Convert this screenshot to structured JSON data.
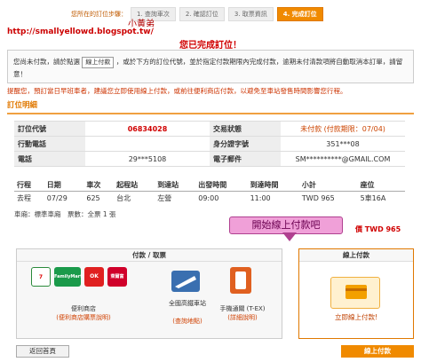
{
  "progress": {
    "label": "您所在的訂位步驟：",
    "steps": [
      "1. 查詢車次",
      "2. 確認訂位",
      "3. 取票資訊",
      "4. 完成訂位"
    ],
    "active_step_index": 3
  },
  "watermark": {
    "author": "小黃弟",
    "url": "http://smallyellowd.blogspot.tw/"
  },
  "done_title": "您已完成訂位！",
  "notice": {
    "text_before_button": "您尚未付款，請於點選",
    "button_label": "線上付款",
    "text_after_button": "，或於下方的訂位代號，並於指定付款期限內完成付款，逾期未付清款項將自動取消本訂單，請留意！"
  },
  "warning": "提醒您，預訂當日早班車者，建議您立即使用線上付款，或前往便利商店付款，以避免至車站發售時間影響您行程。",
  "section_title": "訂位明細",
  "info_rows": [
    {
      "k1": "訂位代號",
      "v1": "06834028",
      "k2": "交易狀態",
      "v2": "未付款 (付款期限：07/04)"
    },
    {
      "k1": "行動電話",
      "v1": "",
      "k2": "身分證字號",
      "v2": "351***08"
    },
    {
      "k1": "電話",
      "v1": "29***5108",
      "k2": "電子郵件",
      "v2": "SM**********@GMAIL.COM"
    }
  ],
  "trip": {
    "headers": [
      "行程",
      "日期",
      "車次",
      "起程站",
      "到達站",
      "出發時間",
      "到達時間",
      "小計",
      "座位"
    ],
    "rows": [
      [
        "去程",
        "07/29",
        "625",
        "台北",
        "左營",
        "09:00",
        "11:00",
        "TWD 965",
        "5車16A"
      ]
    ]
  },
  "car_info": "車廂：標準車廂　票數：全票 1 張",
  "total_suffix": "價 TWD 965",
  "bubble": "開始線上付款吧",
  "payment": {
    "header": "付款 / 取票",
    "store_label": "便利商店",
    "store_link": "(便利商店購票說明)",
    "hsr_label": "全國高鐵車站",
    "hsr_link": "(查詢地點)",
    "app_label": "手機通關 (T-EX)",
    "app_link": "(詳細說明)",
    "logos": [
      "7-ELEVEN",
      "FamilyMart",
      "OK",
      "萊爾富"
    ]
  },
  "online": {
    "header": "線上付款",
    "link": "立即線上付款!"
  },
  "buttons": {
    "home": "返回首頁",
    "pay_online": "線上付款"
  },
  "colors": {
    "accent": "#f08a00",
    "alert": "#d00000",
    "bubble": "#f0a0d8"
  }
}
